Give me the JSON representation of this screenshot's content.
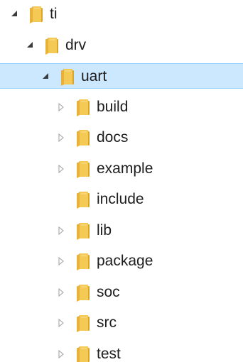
{
  "tree": {
    "items": [
      {
        "label": "ti",
        "state": "expanded",
        "depth": 0
      },
      {
        "label": "drv",
        "state": "expanded",
        "depth": 1
      },
      {
        "label": "uart",
        "state": "expanded",
        "depth": 2,
        "selected": true
      },
      {
        "label": "build",
        "state": "collapsed",
        "depth": 3
      },
      {
        "label": "docs",
        "state": "collapsed",
        "depth": 3
      },
      {
        "label": "example",
        "state": "collapsed",
        "depth": 3
      },
      {
        "label": "include",
        "state": "leaf",
        "depth": 3
      },
      {
        "label": "lib",
        "state": "collapsed",
        "depth": 3
      },
      {
        "label": "package",
        "state": "collapsed",
        "depth": 3
      },
      {
        "label": "soc",
        "state": "collapsed",
        "depth": 3
      },
      {
        "label": "src",
        "state": "collapsed",
        "depth": 3
      },
      {
        "label": "test",
        "state": "collapsed",
        "depth": 3
      }
    ]
  },
  "colors": {
    "selection_bg": "#cce8ff",
    "selection_border": "#99d1ff",
    "folder_main": "#f4c954",
    "folder_dark": "#d9a528",
    "expanded_arrow": "#3c3c3c",
    "collapsed_arrow": "#a0a0a0"
  },
  "icons": {
    "folder": "folder-icon",
    "expanded": "expanded-arrow-icon",
    "collapsed": "collapsed-arrow-icon"
  }
}
